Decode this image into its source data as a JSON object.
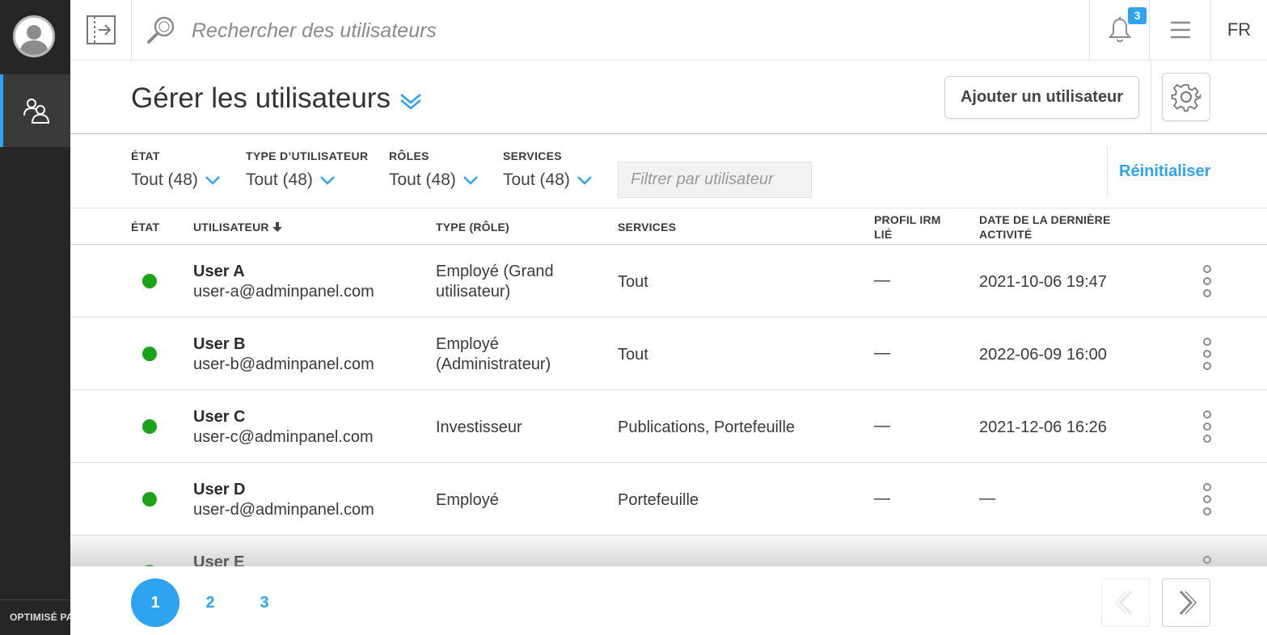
{
  "rail": {
    "footer_label": "OPTIMISÉ PAR"
  },
  "topbar": {
    "search_placeholder": "Rechercher des utilisateurs",
    "notifications_count": "3",
    "language": "FR"
  },
  "header": {
    "title": "Gérer les utilisateurs",
    "add_user_label": "Ajouter un utilisateur"
  },
  "filters": {
    "items": [
      {
        "label": "ÉTAT",
        "value": "Tout (48)"
      },
      {
        "label": "TYPE D’UTILISATEUR",
        "value": "Tout (48)"
      },
      {
        "label": "RÔLES",
        "value": "Tout (48)"
      },
      {
        "label": "SERVICES",
        "value": "Tout (48)"
      }
    ],
    "user_filter_placeholder": "Filtrer par utilisateur",
    "reset_label": "Réinitialiser"
  },
  "table": {
    "columns": {
      "status": "ÉTAT",
      "user": "UTILISATEUR",
      "type": "TYPE (RÔLE)",
      "services": "SERVICES",
      "irm_line1": "PROFIL IRM",
      "irm_line2": "LIÉ",
      "last_line1": "DATE DE LA DERNIÈRE",
      "last_line2": "ACTIVITÉ"
    },
    "rows": [
      {
        "name": "User A",
        "email": "user-a@adminpanel.com",
        "type": "Employé (Grand utilisateur)",
        "services": "Tout",
        "irm": "—",
        "last": "2021-10-06 19:47"
      },
      {
        "name": "User B",
        "email": "user-b@adminpanel.com",
        "type": "Employé (Administrateur)",
        "services": "Tout",
        "irm": "—",
        "last": "2022-06-09 16:00"
      },
      {
        "name": "User C",
        "email": "user-c@adminpanel.com",
        "type": "Investisseur",
        "services": "Publications, Portefeuille",
        "irm": "—",
        "last": "2021-12-06 16:26"
      },
      {
        "name": "User D",
        "email": "user-d@adminpanel.com",
        "type": "Employé",
        "services": "Portefeuille",
        "irm": "—",
        "last": "—"
      },
      {
        "name": "User E",
        "email": "",
        "type": "",
        "services": "",
        "irm": "",
        "last": ""
      }
    ]
  },
  "pagination": {
    "pages": [
      "1",
      "2",
      "3"
    ],
    "current": "1"
  },
  "colors": {
    "accent": "#2ea3f2",
    "status_active": "#1aa31a",
    "rail_bg": "#262626"
  }
}
